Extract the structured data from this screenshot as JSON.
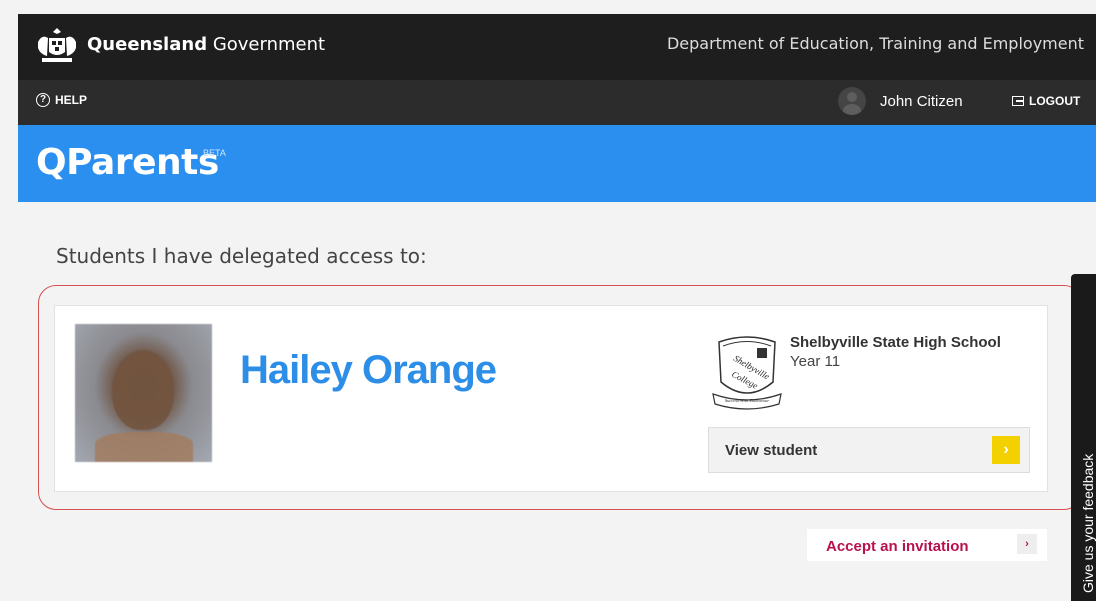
{
  "header": {
    "gov_name_bold": "Queensland",
    "gov_name_light": "Government",
    "department": "Department of Education, Training and Employment"
  },
  "subbar": {
    "help_label": "HELP",
    "user_name": "John Citizen",
    "logout_label": "LOGOUT"
  },
  "app": {
    "title": "QParents",
    "badge": "BETA"
  },
  "main": {
    "section_title": "Students I have delegated access to:",
    "students": [
      {
        "name": "Hailey Orange",
        "school": "Shelbyville State High School",
        "year": "Year 11",
        "view_label": "View student",
        "crest_lines": [
          "Shelbyville",
          "College"
        ],
        "crest_motto": "Success With Endeavour"
      }
    ],
    "accept_label": "Accept an invitation"
  },
  "feedback": {
    "label": "Give us your feedback"
  },
  "colors": {
    "gov_bar": "#1e1e1e",
    "sub_bar": "#2c2c2c",
    "banner": "#2b8ff0",
    "student_name": "#2d8ee8",
    "arrow": "#f3d000",
    "accept": "#b8124e",
    "highlight": "#d55050"
  }
}
